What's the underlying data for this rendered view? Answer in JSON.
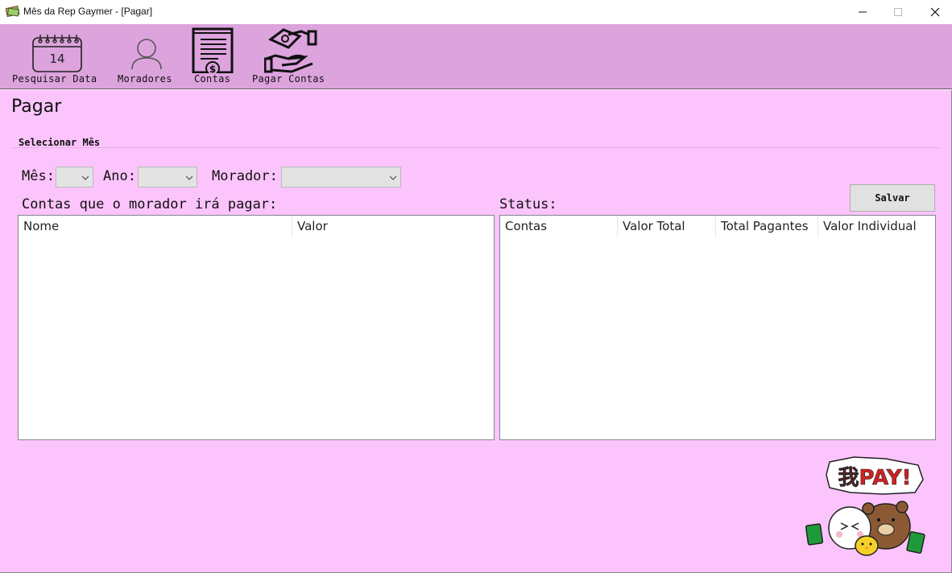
{
  "window": {
    "title": "Mês da Rep Gaymer - [Pagar]"
  },
  "toolbar": {
    "items": [
      {
        "label": "Pesquisar Data",
        "icon": "calendar-icon",
        "calendar_day": "14"
      },
      {
        "label": "Moradores",
        "icon": "user-icon"
      },
      {
        "label": "Contas",
        "icon": "bill-icon"
      },
      {
        "label": "Pagar Contas",
        "icon": "pay-hands-icon"
      }
    ]
  },
  "page": {
    "title": "Pagar",
    "group_title": "Selecionar Mês",
    "filters": {
      "month_label": "Mês:",
      "month_value": "",
      "year_label": "Ano:",
      "year_value": "",
      "resident_label": "Morador:",
      "resident_value": ""
    },
    "save_label": "Salvar",
    "bills_section_label": "Contas que o morador irá pagar:",
    "bills_columns": [
      "Nome",
      "Valor"
    ],
    "bills_rows": [],
    "status_section_label": "Status:",
    "status_columns": [
      "Contas",
      "Valor Total",
      "Total Pagantes",
      "Valor Individual"
    ],
    "status_rows": [],
    "sticker_text": "我PAY!"
  },
  "colors": {
    "toolbar_bg": "#dda3dd",
    "main_bg": "#fcc4fc",
    "button_bg": "#e1e1e1",
    "combo_bg": "#e3e3e3"
  }
}
